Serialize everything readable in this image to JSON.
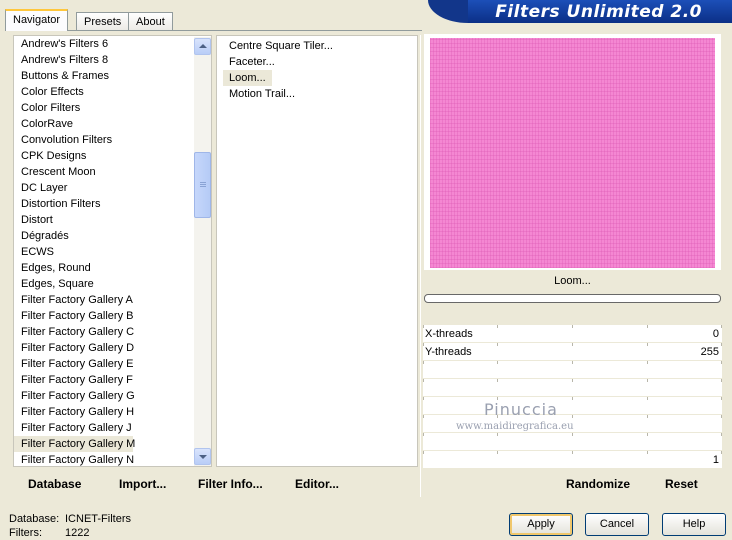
{
  "tabs": [
    {
      "label": "Navigator",
      "active": true
    },
    {
      "label": "Presets",
      "active": false
    },
    {
      "label": "About",
      "active": false
    }
  ],
  "banner": {
    "title": "Filters Unlimited 2.0"
  },
  "categories": {
    "items": [
      "Andrew's Filters 6",
      "Andrew's Filters 8",
      "Buttons & Frames",
      "Color Effects",
      "Color Filters",
      "ColorRave",
      "Convolution Filters",
      "CPK Designs",
      "Crescent Moon",
      "DC Layer",
      "Distortion Filters",
      "Distort",
      "Dégradés",
      "ECWS",
      "Edges, Round",
      "Edges, Square",
      "Filter Factory Gallery A",
      "Filter Factory Gallery B",
      "Filter Factory Gallery C",
      "Filter Factory Gallery D",
      "Filter Factory Gallery E",
      "Filter Factory Gallery F",
      "Filter Factory Gallery G",
      "Filter Factory Gallery H",
      "Filter Factory Gallery J",
      "Filter Factory Gallery M",
      "Filter Factory Gallery N"
    ],
    "selected": "Filter Factory Gallery M"
  },
  "filters": {
    "items": [
      "Centre Square Tiler...",
      "Faceter...",
      "Loom...",
      "Motion Trail..."
    ],
    "selected": "Loom..."
  },
  "preview": {
    "filter_name": "Loom...",
    "fill_color": "#f487d2",
    "progress": 0
  },
  "params": [
    {
      "label": "X-threads",
      "value": "0"
    },
    {
      "label": "Y-threads",
      "value": "255"
    },
    {
      "label": "",
      "value": ""
    },
    {
      "label": "",
      "value": ""
    },
    {
      "label": "",
      "value": ""
    },
    {
      "label": "",
      "value": ""
    },
    {
      "label": "",
      "value": ""
    },
    {
      "label": "",
      "value": "1"
    }
  ],
  "watermark": {
    "line1": "Pinuccia",
    "line2": "www.maidiregrafica.eu"
  },
  "toolbar_left": {
    "database": "Database",
    "import": "Import...",
    "filter_info": "Filter Info...",
    "editor": "Editor..."
  },
  "toolbar_right": {
    "randomize": "Randomize",
    "reset": "Reset"
  },
  "status": {
    "database_label": "Database:",
    "database_value": "ICNET-Filters",
    "filters_label": "Filters:",
    "filters_value": "1222"
  },
  "buttons": {
    "apply": "Apply",
    "cancel": "Cancel",
    "help": "Help"
  }
}
